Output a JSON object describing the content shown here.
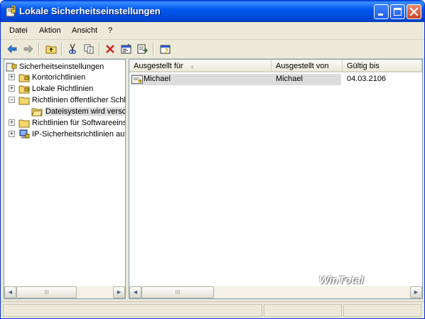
{
  "window": {
    "title": "Lokale Sicherheitseinstellungen"
  },
  "menu": {
    "items": [
      "Datei",
      "Aktion",
      "Ansicht",
      "?"
    ]
  },
  "toolbar": {
    "icons": [
      "back-arrow-icon",
      "forward-arrow-icon",
      "up-folder-icon",
      "cut-icon",
      "copy-icon",
      "delete-icon",
      "properties-icon",
      "export-icon",
      "help-icon"
    ]
  },
  "tree": {
    "items": [
      {
        "label": "Sicherheitseinstellungen"
      },
      {
        "label": "Kontorichtlinien",
        "expander": "+"
      },
      {
        "label": "Lokale Richtlinien",
        "expander": "+"
      },
      {
        "label": "Richtlinien öffentlicher Schl",
        "expander": "−"
      },
      {
        "label": "Dateisystem wird versc"
      },
      {
        "label": "Richtlinien für Softwareeins",
        "expander": "+"
      },
      {
        "label": "IP-Sicherheitsrichtlinien auf",
        "expander": "+"
      }
    ]
  },
  "list": {
    "columns": [
      "Ausgestellt für",
      "Ausgestellt von",
      "Gültig bis"
    ],
    "sort_indicator": "▲",
    "rows": [
      {
        "issued_to": "Michael",
        "issued_by": "Michael",
        "valid_until": "04.03.2106"
      }
    ]
  },
  "scroll": {
    "thumb_grip": "III",
    "left_arrow": "◄",
    "right_arrow": "►"
  },
  "watermark": "WinTotal",
  "colors": {
    "title_bar": "#0058ee",
    "selection": "#dcdcdc",
    "pane_border": "#7f9db9"
  }
}
